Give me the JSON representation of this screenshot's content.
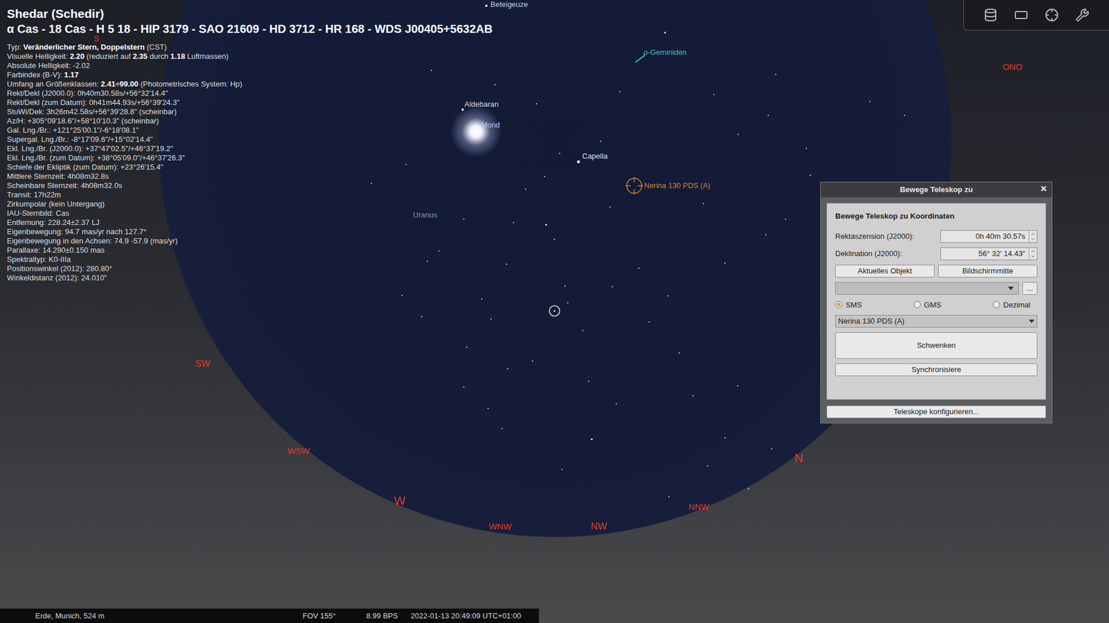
{
  "info": {
    "title": "Shedar (Schedir)",
    "subtitle": "α Cas - 18 Cas - H 5 18 - HIP 3179 - SAO 21609 - HD 3712 - HR 168 - WDS J00405+5632AB",
    "lines": [
      [
        {
          "text": "Typ: ",
          "bold": false
        },
        {
          "text": "Veränderlicher Stern, Doppelstern",
          "bold": true
        },
        {
          "text": " (CST)",
          "bold": false
        }
      ],
      [
        {
          "text": "Visuelle Helligkeit: ",
          "bold": false
        },
        {
          "text": "2.20",
          "bold": true
        },
        {
          "text": " (reduziert auf ",
          "bold": false
        },
        {
          "text": "2.35",
          "bold": true
        },
        {
          "text": " durch ",
          "bold": false
        },
        {
          "text": "1.18",
          "bold": true
        },
        {
          "text": " Luftmassen)",
          "bold": false
        }
      ],
      [
        {
          "text": "Absolute Helligkeit: -2.02",
          "bold": false
        }
      ],
      [
        {
          "text": "Farbindex (B-V): ",
          "bold": false
        },
        {
          "text": "1.17",
          "bold": true
        }
      ],
      [
        {
          "text": "Umfang an Größenklassen: ",
          "bold": false
        },
        {
          "text": "2.41÷99.00",
          "bold": true
        },
        {
          "text": " (Photometrisches System: Hp)",
          "bold": false
        }
      ],
      [
        {
          "text": "Rekt/Dekl (J2000.0): 0h40m30.58s/+56°32'14.4\"",
          "bold": false
        }
      ],
      [
        {
          "text": "Rekt/Dekl (zum Datum): 0h41m44.93s/+56°39'24.3\"",
          "bold": false
        }
      ],
      [
        {
          "text": "StuWi/Dek: 3h26m42.58s/+56°39'28.8\" (scheinbar)",
          "bold": false
        }
      ],
      [
        {
          "text": "Az/H: +305°09'18.6\"/+58°10'10.3\" (scheinbar)",
          "bold": false
        }
      ],
      [
        {
          "text": "Gal. Lng./Br.: +121°25'00.1\"/-6°18'08.1\"",
          "bold": false
        }
      ],
      [
        {
          "text": "Supergal. Lng./Br.: -8°17'09.6\"/+15°02'14.4\"",
          "bold": false
        }
      ],
      [
        {
          "text": "Ekl. Lng./Br. (J2000.0): +37°47'02.5\"/+46°37'19.2\"",
          "bold": false
        }
      ],
      [
        {
          "text": "Ekl. Lng./Br. (zum Datum): +38°05'09.0\"/+46°37'26.3\"",
          "bold": false
        }
      ],
      [
        {
          "text": "Schiefe der Ekliptik (zum Datum): +23°26'15.4\"",
          "bold": false
        }
      ],
      [
        {
          "text": "Mittlere Sternzeit: 4h08m32.8s",
          "bold": false
        }
      ],
      [
        {
          "text": "Scheinbare Sternzeit: 4h08m32.0s",
          "bold": false
        }
      ],
      [
        {
          "text": "Transit: 17h22m",
          "bold": false
        }
      ],
      [
        {
          "text": "Zirkumpolar (kein Untergang)",
          "bold": false
        }
      ],
      [
        {
          "text": "IAU-Sternbild: Cas",
          "bold": false
        }
      ],
      [
        {
          "text": "Entfernung: 228.24±2.37 LJ",
          "bold": false
        }
      ],
      [
        {
          "text": "Eigenbewegung: 94.7 mas/yr nach 127.7°",
          "bold": false
        }
      ],
      [
        {
          "text": "Eigenbewegung in den Achsen: 74.9 -57.9 (mas/yr)",
          "bold": false
        }
      ],
      [
        {
          "text": "Parallaxe: 14.290±0.150 mas",
          "bold": false
        }
      ],
      [
        {
          "text": "Spektraltyp: K0-IIIa",
          "bold": false
        }
      ],
      [
        {
          "text": "Positionswinkel (2012): 280.80°",
          "bold": false
        }
      ],
      [
        {
          "text": "Winkeldistanz (2012): 24.010\"",
          "bold": false
        }
      ]
    ]
  },
  "sky_labels": [
    {
      "text": "Beteigeuze",
      "color": "#cfcfd6"
    },
    {
      "text": "ρ-Geminiden",
      "color": "#3fc2b8"
    },
    {
      "text": "Aldebaran",
      "color": "#d8d8e0"
    },
    {
      "text": "Mond",
      "color": "#b7c8ec"
    },
    {
      "text": "Capella",
      "color": "#e0e0e6"
    },
    {
      "text": "Nerina 130 PDS (A)",
      "color": "#d9822b"
    },
    {
      "text": "Uranus",
      "color": "#8394c6"
    }
  ],
  "compass": [
    "ONO",
    "S",
    "SW",
    "WSW",
    "W",
    "WNW",
    "NW",
    "N",
    "NNW"
  ],
  "dialog": {
    "title": "Bewege Teleskop zu",
    "close": "✕",
    "heading": "Bewege Teleskop zu Koordinaten",
    "fields": [
      {
        "label": "Rektaszension (J2000):",
        "value": "0h 40m 30.57s"
      },
      {
        "label": "Deklination (J2000):",
        "value": "56° 32' 14.43\""
      }
    ],
    "buttons": [
      "Aktuelles Objekt",
      "Bildschirmmitte"
    ],
    "combo": "",
    "more": "...",
    "radios": [
      {
        "label": "SMS",
        "selected": true
      },
      {
        "label": "GMS",
        "selected": false
      },
      {
        "label": "Dezimal",
        "selected": false
      }
    ],
    "telescope": "Nerina 130 PDS (A)",
    "slew": "Schwenken",
    "sync": "Synchronisiere",
    "configure": "Teleskope konfigurieren..."
  },
  "status_bar": [
    "Erde, Munich, 524 m",
    "FOV 155°",
    "8.99 BPS",
    "2022-01-13 20:49:09 UTC+01:00"
  ]
}
